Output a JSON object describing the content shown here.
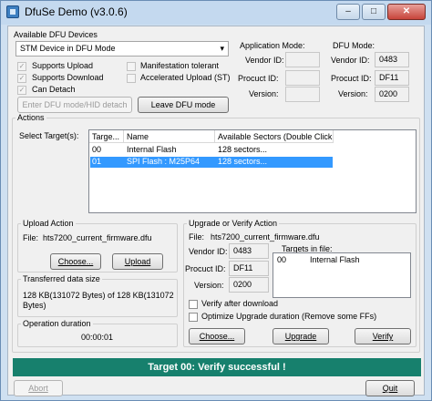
{
  "window": {
    "title": "DfuSe Demo (v3.0.6)"
  },
  "titlebar_buttons": {
    "minimize": "–",
    "maximize": "□",
    "close": "✕"
  },
  "available": {
    "group_title": "Available DFU Devices",
    "device_selected": "STM Device in DFU Mode",
    "supports_upload": "Supports Upload",
    "supports_download": "Supports Download",
    "can_detach": "Can Detach",
    "manifestation_tolerant": "Manifestation tolerant",
    "accelerated_upload": "Accelerated Upload (ST)",
    "enter_dfu_button": "Enter DFU mode/HID detach",
    "leave_dfu_button": "Leave DFU mode"
  },
  "app_mode": {
    "title": "Application Mode:",
    "vendor_label": "Vendor ID:",
    "product_label": "Procuct ID:",
    "version_label": "Version:"
  },
  "dfu_mode": {
    "title": "DFU Mode:",
    "vendor_label": "Vendor ID:",
    "vendor_value": "0483",
    "product_label": "Procuct ID:",
    "product_value": "DF11",
    "version_label": "Version:",
    "version_value": "0200"
  },
  "actions": {
    "group_title": "Actions",
    "select_targets_label": "Select Target(s):",
    "columns": [
      "Targe...",
      "Name",
      "Available Sectors (Double Click..."
    ],
    "rows": [
      {
        "target": "00",
        "name": "Internal Flash",
        "sectors": "128 sectors..."
      },
      {
        "target": "01",
        "name": "SPI Flash : M25P64",
        "sectors": "128 sectors..."
      }
    ]
  },
  "upload": {
    "group_title": "Upload Action",
    "file_label": "File:",
    "file_value": "hts7200_current_firmware.dfu",
    "choose_button": "Choose...",
    "upload_button": "Upload"
  },
  "transferred": {
    "group_title": "Transferred data size",
    "value": "128 KB(131072 Bytes) of 128 KB(131072 Bytes)"
  },
  "duration": {
    "group_title": "Operation duration",
    "value": "00:00:01"
  },
  "upgrade": {
    "group_title": "Upgrade or Verify Action",
    "file_label": "File:",
    "file_value": "hts7200_current_firmware.dfu",
    "vendor_label": "Vendor ID:",
    "vendor_value": "0483",
    "product_label": "Procuct ID:",
    "product_value": "DF11",
    "version_label": "Version:",
    "version_value": "0200",
    "targets_title": "Targets in file:",
    "targets": [
      {
        "id": "00",
        "name": "Internal Flash"
      }
    ],
    "verify_after_download": "Verify after download",
    "optimize_upgrade": "Optimize Upgrade duration (Remove some FFs)",
    "choose_button": "Choose...",
    "upgrade_button": "Upgrade",
    "verify_button": "Verify"
  },
  "status": "Target 00: Verify successful !",
  "bottom": {
    "abort_button": "Abort",
    "quit_button": "Quit"
  }
}
